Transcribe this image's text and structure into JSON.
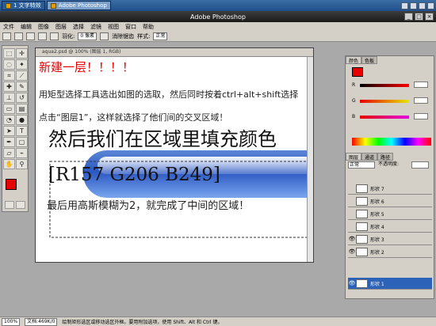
{
  "taskbar": {
    "tabs": [
      {
        "label": "1 文字特效",
        "active": false
      },
      {
        "label": "Adobe Photoshop",
        "active": true
      }
    ]
  },
  "app": {
    "title": "Adobe Photoshop"
  },
  "menu": [
    "文件",
    "编辑",
    "图像",
    "图层",
    "选择",
    "滤镜",
    "视图",
    "窗口",
    "帮助"
  ],
  "options": {
    "feather_label": "羽化:",
    "feather_value": "0 像素",
    "antialias_label": "消除锯齿",
    "style_label": "样式:",
    "style_value": "正常"
  },
  "document": {
    "title": "aqua2.psd @ 100% (图层 1, RGB)"
  },
  "canvas": {
    "line1": "新建一层！！！！",
    "line2": "用矩型选择工具选出如图的选取，然后同时按着ctrl+alt+shift选择",
    "line3": "点击“图层1”，这样就选择了他们间的交叉区域！",
    "line4": "然后我们在区域里填充颜色",
    "line5": "[R157 G206 B249]",
    "line6": "最后用高斯模糊为2，就完成了中间的区域！"
  },
  "colors": {
    "foreground": "#e60000",
    "background": "#ffffff",
    "fill_color": "#9dcef9",
    "accent_red": "#e60000"
  },
  "panels": {
    "nav_tabs": [
      "颜色",
      "色板"
    ],
    "layers_tabs": [
      "图层",
      "通道",
      "路径"
    ],
    "blend_mode": "正常",
    "opacity_label": "不透明度:",
    "layers": [
      {
        "name": "形状 7",
        "selected": false
      },
      {
        "name": "形状 6",
        "selected": false
      },
      {
        "name": "形状 5",
        "selected": false
      },
      {
        "name": "形状 4",
        "selected": false
      },
      {
        "name": "形状 3",
        "selected": false
      },
      {
        "name": "形状 2",
        "selected": false
      },
      {
        "name": "形状 1",
        "selected": true
      }
    ]
  },
  "status": {
    "zoom": "100%",
    "doc_size": "文档:469K/0",
    "hint": "绘制矩形选区或移动选区外框。要用附加选项，使用 Shift、Alt 和 Ctrl 键。"
  }
}
